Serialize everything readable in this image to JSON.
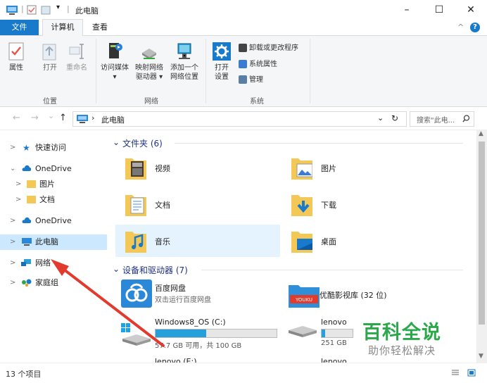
{
  "window": {
    "title": "此电脑",
    "minimize": "–",
    "maximize": "☐",
    "close": "✕"
  },
  "tabs": {
    "file": "文件",
    "computer": "计算机",
    "view": "查看",
    "collapse": "^",
    "help": "?"
  },
  "ribbon": {
    "location_group": {
      "label": "位置",
      "items": [
        "属性",
        "打开",
        "重命名"
      ]
    },
    "network_group": {
      "label": "网络",
      "items": [
        {
          "line1": "访问媒体",
          "line2": "▾"
        },
        {
          "line1": "映射网络",
          "line2": "驱动器 ▾"
        },
        {
          "line1": "添加一个",
          "line2": "网络位置"
        }
      ]
    },
    "system_group": {
      "label": "系统",
      "open_settings_1": "打开",
      "open_settings_2": "设置",
      "small": [
        "卸载或更改程序",
        "系统属性",
        "管理"
      ]
    }
  },
  "navbar": {
    "back": "←",
    "forward": "→",
    "down": "⌄",
    "up": "↑",
    "address": "此电脑",
    "refresh": "↻",
    "search_placeholder": "搜索\"此电...",
    "dropdown": "⌄"
  },
  "nav_pane": [
    {
      "label": "快速访问",
      "chev": ">"
    },
    {
      "label": "OneDrive",
      "chev": "⌄"
    },
    {
      "label": "图片",
      "chev": ">"
    },
    {
      "label": "文档",
      "chev": ">"
    },
    {
      "label": "OneDrive",
      "chev": ">"
    },
    {
      "label": "此电脑",
      "chev": ">"
    },
    {
      "label": "网络",
      "chev": ">"
    },
    {
      "label": "家庭组",
      "chev": ">"
    }
  ],
  "folders_section": {
    "title": "文件夹 (6)",
    "items": [
      "视频",
      "图片",
      "文档",
      "下载",
      "音乐",
      "桌面"
    ]
  },
  "devices_section": {
    "title": "设备和驱动器 (7)",
    "apps": [
      {
        "name": "百度网盘",
        "sub": "双击运行百度网盘"
      },
      {
        "name": "优酷影视库 (32 位)",
        "sub": ""
      }
    ],
    "drives": [
      {
        "name": "Windows8_OS (C:)",
        "info": "57.7 GB 可用，共 100 GB",
        "fill": 0.42
      },
      {
        "name": "lenovo",
        "info": "251 GB",
        "fill": 0.12
      }
    ],
    "more": [
      "lenovo (E:)",
      "lenovo"
    ]
  },
  "status": {
    "items": "13 个项目"
  },
  "watermark": {
    "line1": "百科全说",
    "line2": "助你轻松解决"
  },
  "colors": {
    "accent": "#1979ca",
    "selected": "#cce8ff",
    "hover": "#e5f3ff",
    "arrow": "#e23b2e"
  }
}
